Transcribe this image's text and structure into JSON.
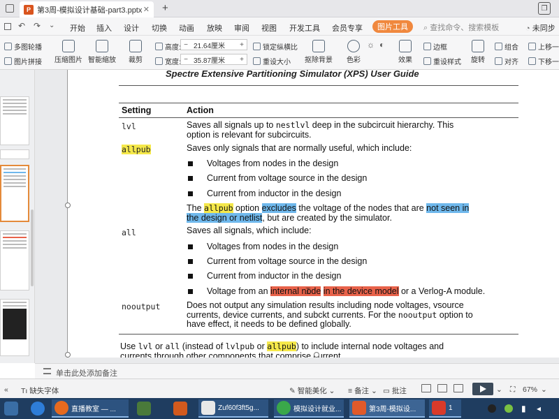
{
  "window": {
    "doc_tab_title": "第3周-模拟设计基础-part3.pptx",
    "new_tab": "+",
    "tab_close": "✕"
  },
  "menu": {
    "items": [
      "开始",
      "插入",
      "设计",
      "切换",
      "动画",
      "放映",
      "审阅",
      "视图",
      "开发工具",
      "会员专享"
    ],
    "active_tool": "图片工具",
    "search_placeholder": "查找命令、搜索模板",
    "sync": "未同步"
  },
  "ribbon": {
    "multi_outline": "多图轮播",
    "picture_collage": "图片拼接",
    "compress": "压缩图片",
    "smart_zoom": "智能缩放",
    "crop": "裁剪",
    "height_label": "高度:",
    "height_value": "21.64厘米",
    "width_label": "宽度:",
    "width_value": "35.87厘米",
    "lock_ratio": "锁定纵横比",
    "reset_size": "重设大小",
    "remove_bg": "抠除背景",
    "color": "色彩",
    "effects": "效果",
    "border": "边框",
    "reset_style": "重设样式",
    "rotate": "旋转",
    "group": "组合",
    "align": "对齐",
    "bring_forward": "上移一",
    "send_backward": "下移一"
  },
  "slide": {
    "header": "Spectre Extensive Partitioning Simulator (XPS) User Guide",
    "col_setting": "Setting",
    "col_action": "Action",
    "rows": {
      "lvl": {
        "setting": "lvl",
        "line1_a": "Saves all signals up to ",
        "line1_code": "nestlvl",
        "line1_b": " deep in the subcircuit hierarchy. This",
        "line2": "option is relevant for subcircuits."
      },
      "allpub": {
        "setting": "allpub",
        "intro": "Saves only signals that are normally useful, which include:",
        "bullets": [
          "Voltages from nodes in the design",
          "Current from voltage source in the design",
          "Current from inductor in the design"
        ],
        "note_the": "The ",
        "note_code": "allpub",
        "note_option": " option ",
        "note_excludes": "excludes",
        "note_mid": " the voltage of the nodes that are ",
        "note_not_seen": "not seen in",
        "note_design_netlist": "the design or netlist",
        "note_end": ", but are created by the simulator."
      },
      "all": {
        "setting": "all",
        "intro": "Saves all signals, which include:",
        "bullets": [
          "Voltages from nodes in the design",
          "Current from voltage source in the design",
          "Current from inductor in the design"
        ],
        "last_a": "Voltage from an ",
        "last_internal": "internal node",
        "last_space": " ",
        "last_device": "in the device model",
        "last_b": " or a Verlog-A module."
      },
      "nooutput": {
        "setting": "nooutput",
        "line1": "Does not output any simulation results including node voltages, vsource",
        "line2_a": "currents, device currents, and subckt currents. For the ",
        "line2_code": "nooutput",
        "line2_b": " option to",
        "line3": "have effect, it needs to be defined globally."
      }
    },
    "footer_a": "Use ",
    "footer_c1": "lvl",
    "footer_or1": " or ",
    "footer_c2": "all",
    "footer_mid": " (instead of ",
    "footer_c3": "lvlpub",
    "footer_or2": " or ",
    "footer_c4": "allpub",
    "footer_b": ") to include internal node voltages and",
    "footer_line2": "currents through other components that comprise current."
  },
  "notes": {
    "placeholder": "单击此处添加备注"
  },
  "status": {
    "missing_font": "缺失字体",
    "smart_beautify": "智能美化",
    "notes": "备注",
    "comments": "批注",
    "zoom": "67%"
  },
  "taskbar": {
    "items": [
      "直播教室 — ...",
      "",
      "",
      "Zuf60f3ft5g...",
      "模拟设计就业...",
      "第3周-模拟设...",
      "1"
    ]
  },
  "colors": {
    "accent_orange": "#f0883e",
    "highlight_yellow": "#f5e84a",
    "highlight_blue": "#6fb8ec",
    "highlight_red": "#e8624a",
    "taskbar_blue": "#1f3d60"
  }
}
